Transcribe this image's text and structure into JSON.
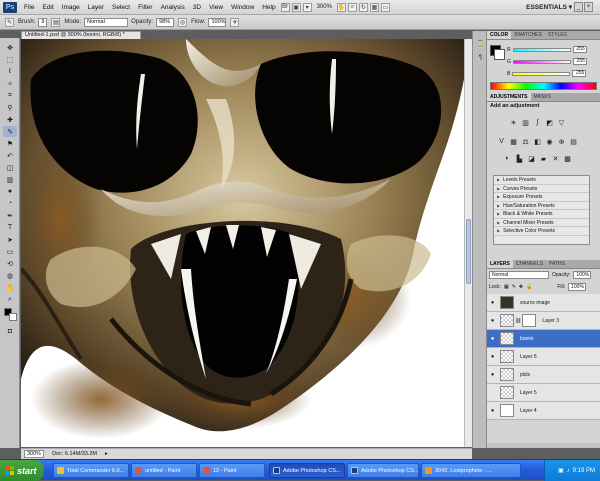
{
  "menubar": {
    "logo": "Ps",
    "items": [
      "File",
      "Edit",
      "Image",
      "Layer",
      "Select",
      "Filter",
      "Analysis",
      "3D",
      "View",
      "Window",
      "Help"
    ],
    "zoom": "300%",
    "workspace": "ESSENTIALS ▾"
  },
  "options": {
    "brush_label": "Brush:",
    "brush_size": "9",
    "mode_label": "Mode:",
    "mode_value": "Normal",
    "opacity_label": "Opacity:",
    "opacity_value": "98%",
    "flow_label": "Flow:",
    "flow_value": "100%"
  },
  "document": {
    "tab_title": "Untitled-1.psd @ 300% (bonini, RGB/8) *",
    "status_zoom": "300%",
    "status_doc": "Doc: 6.14M/33.2M"
  },
  "color_panel": {
    "tabs": [
      "COLOR",
      "SWATCHES",
      "STYLES"
    ],
    "channels": [
      {
        "label": "R",
        "value": "255"
      },
      {
        "label": "G",
        "value": "255"
      },
      {
        "label": "B",
        "value": "255"
      }
    ]
  },
  "adjustments_panel": {
    "tabs": [
      "ADJUSTMENTS",
      "MASKS"
    ],
    "title": "Add an adjustment",
    "presets": [
      "Levels Presets",
      "Curves Presets",
      "Exposure Presets",
      "Hue/Saturation Presets",
      "Black & White Presets",
      "Channel Mixer Presets",
      "Selective Color Presets"
    ]
  },
  "layers_panel": {
    "tabs": [
      "LAYERS",
      "CHANNELS",
      "PATHS"
    ],
    "blend_mode": "Normal",
    "opacity_label": "Opacity:",
    "opacity_value": "100%",
    "lock_label": "Lock:",
    "fill_label": "Fill:",
    "fill_value": "100%",
    "layers": [
      {
        "name": "source image",
        "visible": true,
        "selected": false,
        "thumb": "dark",
        "mask": false
      },
      {
        "name": "Layer 3",
        "visible": true,
        "selected": false,
        "thumb": "checker",
        "mask": true
      },
      {
        "name": "bonini",
        "visible": true,
        "selected": true,
        "thumb": "checker",
        "mask": false
      },
      {
        "name": "Layer 6",
        "visible": true,
        "selected": false,
        "thumb": "checker",
        "mask": false
      },
      {
        "name": "pixls",
        "visible": true,
        "selected": false,
        "thumb": "checker",
        "mask": false
      },
      {
        "name": "Layer 5",
        "visible": false,
        "selected": false,
        "thumb": "checker",
        "mask": false
      },
      {
        "name": "Layer 4",
        "visible": true,
        "selected": false,
        "thumb": "white",
        "mask": false
      }
    ]
  },
  "taskbar": {
    "start_label": "start",
    "tasks": [
      {
        "label": "Total Commander 6.0...",
        "color": "#f2c230",
        "active": false
      },
      {
        "label": "untitled - Paint",
        "color": "#e2553c",
        "active": false
      },
      {
        "label": "12 - Paint",
        "color": "#e2553c",
        "active": false
      },
      {
        "label": "Adobe Photoshop CS...",
        "color": "#1c3e74",
        "active": true
      },
      {
        "label": "Adobe Photoshop CS...",
        "color": "#1c3e74",
        "active": false
      },
      {
        "label": "3043. Lostprophets - ...",
        "color": "#f39a1e",
        "active": false
      }
    ],
    "clock": "9:19 PM"
  }
}
